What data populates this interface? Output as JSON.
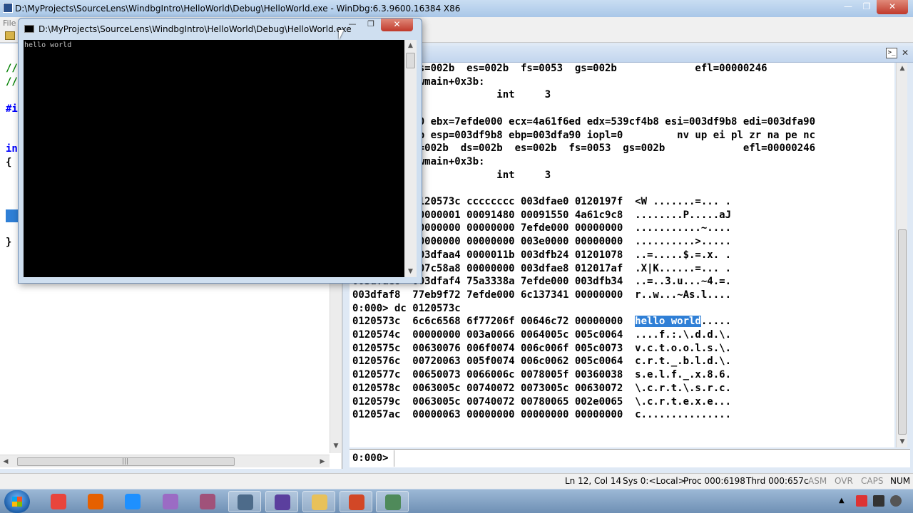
{
  "main_window": {
    "title": "D:\\MyProjects\\SourceLens\\WindbgIntro\\HelloWorld\\Debug\\HelloWorld.exe - WinDbg:6.3.9600.16384 X86",
    "minimize_glyph": "—",
    "maximize_glyph": "❐",
    "close_glyph": "✕"
  },
  "menubar": {
    "file_label": "File"
  },
  "source": {
    "lines": [
      {
        "text": "//",
        "kind": "comment"
      },
      {
        "text": "//",
        "kind": "comment"
      },
      {
        "text": "#i",
        "kind": "preproc"
      },
      {
        "text": "in",
        "kind": "kw"
      },
      {
        "text": "{",
        "kind": "plain"
      },
      {
        "text": "}",
        "kind": "plain"
      }
    ],
    "hscroll_grip": "|||"
  },
  "console_window": {
    "title": "D:\\MyProjects\\SourceLens\\WindbgIntro\\HelloWorld\\Debug\\HelloWorld.exe",
    "output": "hello world",
    "minimize_glyph": "—",
    "maximize_glyph": "❐",
    "close_glyph": "✕"
  },
  "command_window": {
    "icon_label": ">_",
    "close_glyph": "✕",
    "output_lines": [
      "eax=002b  ds=002b  es=002b  fs=0053  gs=002b             efl=00000246",
      "HelloWorld!wmain+0x3b:",
      "0120104b cc             int     3",
      "",
      "eax=00000000 ebx=7efde000 ecx=4a61f6ed edx=539cf4b8 esi=003df9b8 edi=003dfa90",
      "eip=0120104b esp=003df9b8 ebp=003dfa90 iopl=0         nv up ei pl zr na pe nc",
      "cs=0023  ss=002b  ds=002b  es=002b  fs=0053  gs=002b             efl=00000246",
      "HelloWorld!wmain+0x3b:",
      "0120104b cc             int     3",
      "",
      "003df9b8  0120573c cccccccc 003dfae0 0120197f  <W .......=... .",
      "003df9c8  00000001 00091480 00091550 4a61c9c8  ........P.....aJ",
      "003df9d8  00000000 00000000 7efde000 00000000  ...........~....",
      "003df9e8  00000000 00000000 003e0000 00000000  ..........>.....",
      "003df9f8  003dfaa4 0000011b 003dfb24 01201078  ..=.....$.=.x. .",
      "003dfa08  507c58a8 00000000 003dfae8 012017af  .X|K......=... .",
      "003dfae8  003dfaf4 75a3338a 7efde000 003dfb34  ..=..3.u...~4.=.",
      "003dfaf8  77eb9f72 7efde000 6c137341 00000000  r..w...~As.l....",
      "0:000> dc 0120573c",
      "0120573c  6c6c6568 6f77206f 00646c72 00000000  hello world.....",
      "0120574c  00000000 003a0066 0064005c 005c0064  ....f.:.\\.d.d.\\.",
      "0120575c  00630076 006f0074 006c006f 005c0073  v.c.t.o.o.l.s.\\.",
      "0120576c  00720063 005f0074 006c0062 005c0064  c.r.t._.b.l.d.\\.",
      "0120577c  00650073 0066006c 0078005f 00360038  s.e.l.f._.x.8.6.",
      "0120578c  0063005c 00740072 0073005c 00630072  \\.c.r.t.\\.s.r.c.",
      "0120579c  0063005c 00740072 00780065 002e0065  \\.c.r.t.e.x.e...",
      "012057ac  00000063 00000000 00000000 00000000  c..............."
    ],
    "highlight": {
      "line_index": 19,
      "text": "hello world"
    },
    "prompt": "0:000>",
    "input_value": ""
  },
  "statusbar": {
    "cells": [
      {
        "text": "Ln 12, Col 14",
        "dim": false
      },
      {
        "text": "Sys 0:<Local>",
        "dim": false
      },
      {
        "text": "Proc 000:6198",
        "dim": false
      },
      {
        "text": "Thrd 000:657c",
        "dim": false
      },
      {
        "text": "ASM",
        "dim": true
      },
      {
        "text": "OVR",
        "dim": true
      },
      {
        "text": "CAPS",
        "dim": true
      },
      {
        "text": "NUM",
        "dim": false
      }
    ]
  },
  "taskbar": {
    "items": [
      {
        "name": "chrome",
        "color": "#e8453c"
      },
      {
        "name": "firefox",
        "color": "#e66000"
      },
      {
        "name": "internet-explorer",
        "color": "#1e90ff"
      },
      {
        "name": "visual-studio-4",
        "color": "#9b6bc4"
      },
      {
        "name": "visual-studio-alt",
        "color": "#a0527a"
      },
      {
        "name": "windbg",
        "color": "#4d6b8a"
      },
      {
        "name": "visual-studio",
        "color": "#5b3f9e"
      },
      {
        "name": "file-explorer",
        "color": "#e8c15a"
      },
      {
        "name": "powerpoint",
        "color": "#d24726"
      },
      {
        "name": "app-window",
        "color": "#4f8a5a"
      }
    ],
    "tray_arrow": "▲"
  }
}
